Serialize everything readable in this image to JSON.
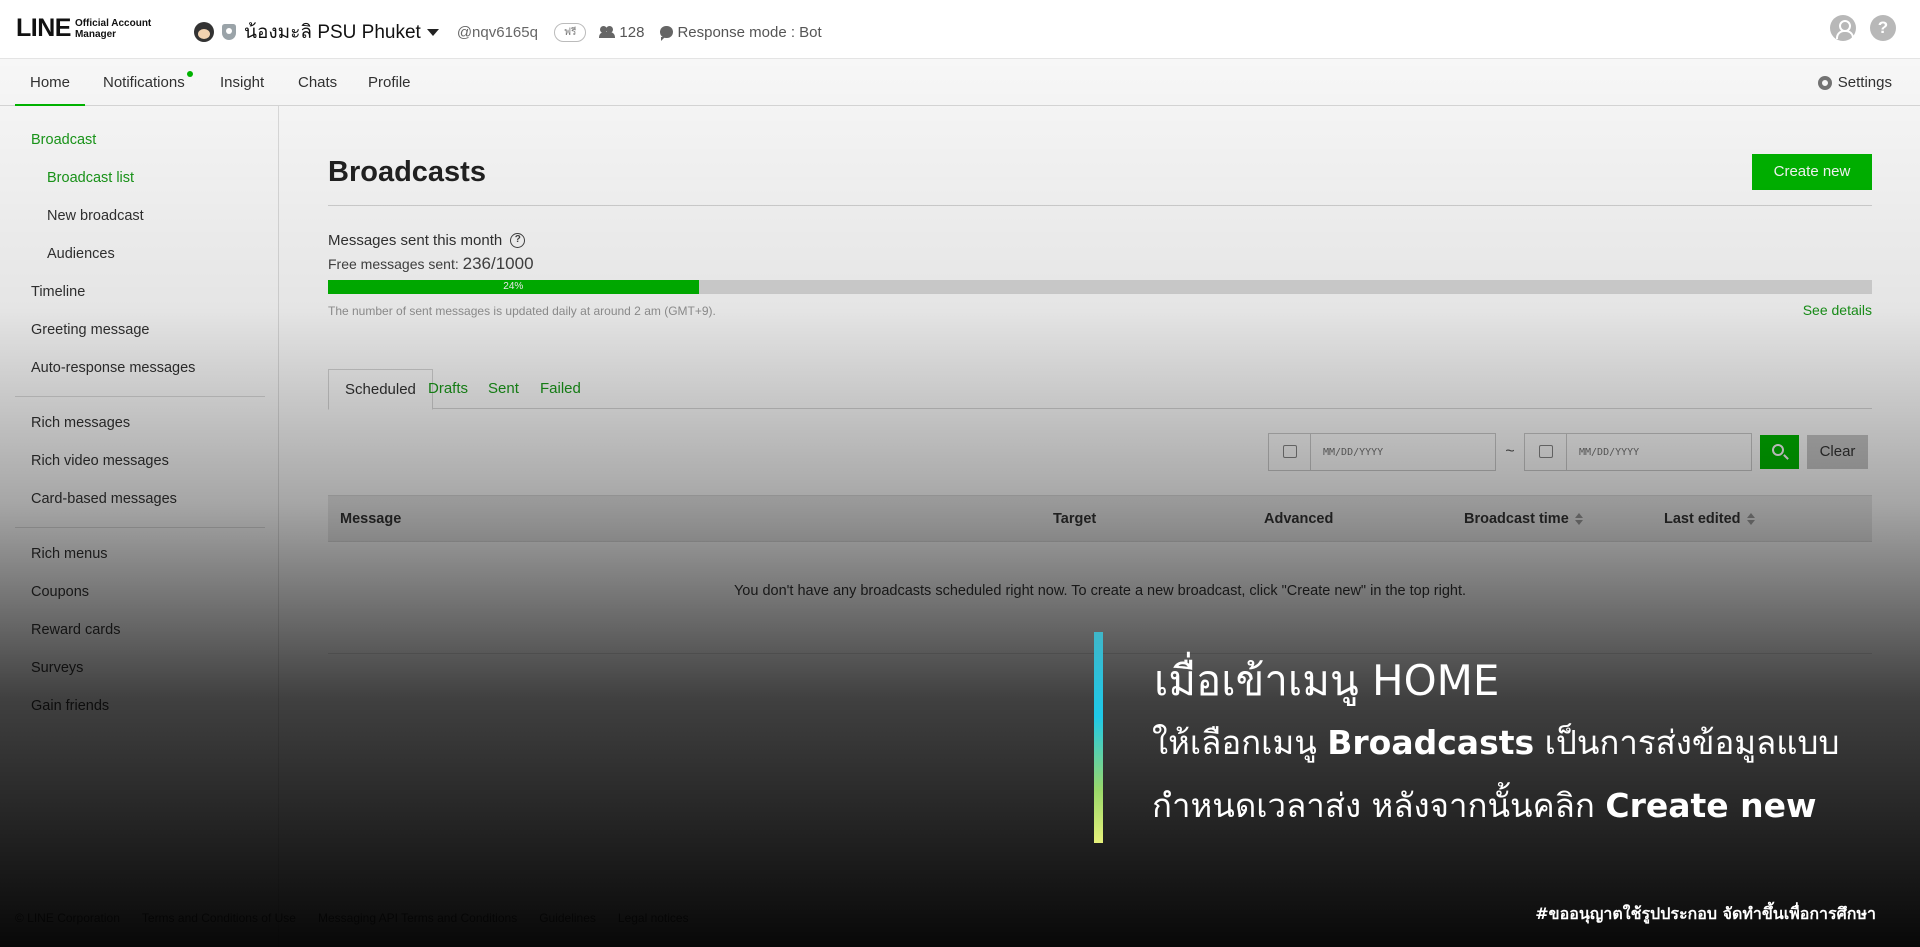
{
  "header": {
    "logo_main": "LINE",
    "logo_sub_1": "Official Account",
    "logo_sub_2": "Manager",
    "account_name": "น้องมะลิ PSU Phuket",
    "account_id": "@nqv6165q",
    "plan_badge": "ฟรี",
    "friends_count": "128",
    "response_mode": "Response mode : Bot",
    "help_glyph": "?"
  },
  "nav": {
    "items": [
      "Home",
      "Notifications",
      "Insight",
      "Chats",
      "Profile"
    ],
    "settings": "Settings"
  },
  "sidebar": {
    "broadcast": "Broadcast",
    "broadcast_list": "Broadcast list",
    "new_broadcast": "New broadcast",
    "audiences": "Audiences",
    "timeline": "Timeline",
    "greeting": "Greeting message",
    "auto_response": "Auto-response messages",
    "rich_messages": "Rich messages",
    "rich_video": "Rich video messages",
    "card_based": "Card-based messages",
    "rich_menus": "Rich menus",
    "coupons": "Coupons",
    "reward_cards": "Reward cards",
    "surveys": "Surveys",
    "gain_friends": "Gain friends"
  },
  "main": {
    "title": "Broadcasts",
    "create_new": "Create new",
    "messages_sent_label": "Messages sent this month",
    "free_label": "Free messages sent:",
    "free_value": "236/1000",
    "progress_percent": 24,
    "progress_label": "24%",
    "update_note": "The number of sent messages is updated daily at around 2 am (GMT+9).",
    "see_details": "See details",
    "tabs": [
      "Scheduled",
      "Drafts",
      "Sent",
      "Failed"
    ],
    "date_placeholder": "MM/DD/YYYY",
    "tilde": "~",
    "clear": "Clear",
    "columns": [
      "Message",
      "Target",
      "Advanced",
      "Broadcast time",
      "Last edited"
    ],
    "empty_message": "You don't have any broadcasts scheduled right now. To create a new broadcast, click \"Create new\" in the top right."
  },
  "footer": {
    "links": [
      "© LINE Corporation",
      "Terms and Conditions of Use",
      "Messaging API Terms and Conditions",
      "Guidelines",
      "Legal notices"
    ]
  },
  "caption": {
    "line1": "เมื่อเข้าเมนู HOME",
    "line2_pre": "ให้เลือกเมนู ",
    "line2_bold": "Broadcasts",
    "line2_post": " เป็นการส่งข้อมูลแบบ",
    "line3_pre": "กำหนดเวลาส่ง หลังจากนั้นคลิก ",
    "line3_bold": "Create new",
    "credit": "#ขออนุญาตใช้รูปประกอบ จัดทำขึ้นเพื่อการศึกษา"
  },
  "colors": {
    "brand_green": "#00b900",
    "link_green": "#1a9b1a"
  }
}
